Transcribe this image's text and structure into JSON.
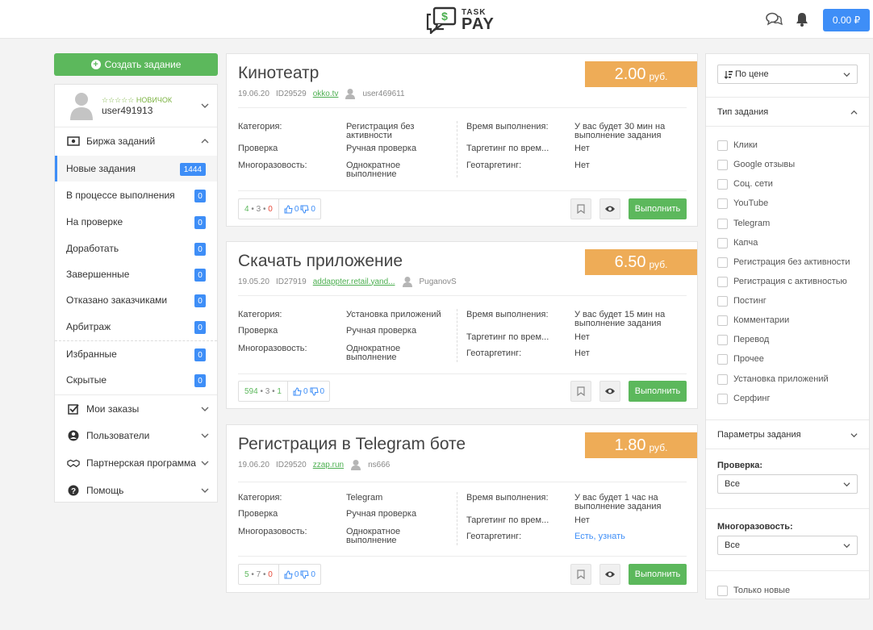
{
  "header": {
    "logo_top": "TASK",
    "logo_bottom": "PAY",
    "balance": "0.00 ₽"
  },
  "sidebar": {
    "create_label": "Создать задание",
    "user": {
      "rank": "☆☆☆☆☆ НОВИЧОК",
      "name": "user491913"
    },
    "exchange_label": "Биржа заданий",
    "items": [
      {
        "label": "Новые задания",
        "count": "1444"
      },
      {
        "label": "В процессе выполнения",
        "count": "0"
      },
      {
        "label": "На проверке",
        "count": "0"
      },
      {
        "label": "Доработать",
        "count": "0"
      },
      {
        "label": "Завершенные",
        "count": "0"
      },
      {
        "label": "Отказано заказчиками",
        "count": "0"
      },
      {
        "label": "Арбитраж",
        "count": "0"
      },
      {
        "label": "Избранные",
        "count": "0"
      },
      {
        "label": "Скрытые",
        "count": "0"
      }
    ],
    "sections": [
      {
        "label": "Мои заказы"
      },
      {
        "label": "Пользователи"
      },
      {
        "label": "Партнерская программа"
      },
      {
        "label": "Помощь"
      }
    ]
  },
  "labels": {
    "category": "Категория:",
    "check": "Проверка",
    "multi": "Многоразовость:",
    "time": "Время выполнения:",
    "time_targeting": "Таргетинг по врем...",
    "geo": "Геотаргетинг:",
    "execute": "Выполнить"
  },
  "tasks": [
    {
      "title": "Кинотеатр",
      "price": "2.00",
      "currency": "руб.",
      "date": "19.06.20",
      "id": "ID29529",
      "site": "okko.tv",
      "author": "user469611",
      "category_1": "Регистрация без",
      "category_2": "активности",
      "check": "Ручная проверка",
      "multi_1": "Однократное",
      "multi_2": "выполнение",
      "time_1": "У вас будет 30 мин на",
      "time_2": "выполнение задания",
      "time_targeting": "Нет",
      "geo": "Нет",
      "stat_a": "4",
      "stat_b": "3",
      "stat_c": "0",
      "likes": "0",
      "dislikes": "0"
    },
    {
      "title": "Скачать приложение",
      "price": "6.50",
      "currency": "руб.",
      "date": "19.05.20",
      "id": "ID27919",
      "site": "addappter.retail.yand...",
      "author": "PuganovS",
      "category_1": "Установка приложений",
      "category_2": "",
      "check": "Ручная проверка",
      "multi_1": "Однократное",
      "multi_2": "выполнение",
      "time_1": "У вас будет 15 мин на",
      "time_2": "выполнение задания",
      "time_targeting": "Нет",
      "geo": "Нет",
      "stat_a": "594",
      "stat_b": "3",
      "stat_c": "1",
      "likes": "0",
      "dislikes": "0"
    },
    {
      "title": "Регистрация в Telegram боте",
      "price": "1.80",
      "currency": "руб.",
      "date": "19.06.20",
      "id": "ID29520",
      "site": "zzap.run",
      "author": "ns666",
      "category_1": "Telegram",
      "category_2": "",
      "check": "Ручная проверка",
      "multi_1": "Однократное",
      "multi_2": "выполнение",
      "time_1": "У вас будет 1 час на",
      "time_2": "выполнение задания",
      "time_targeting": "Нет",
      "geo": "Есть, узнать",
      "stat_a": "5",
      "stat_b": "7",
      "stat_c": "0",
      "likes": "0",
      "dislikes": "0"
    }
  ],
  "filters": {
    "sort_value": "По цене",
    "type_header": "Тип задания",
    "types": [
      "Клики",
      "Google отзывы",
      "Соц. сети",
      "YouTube",
      "Telegram",
      "Капча",
      "Регистрация без активности",
      "Регистрация с активностью",
      "Постинг",
      "Комментарии",
      "Перевод",
      "Прочее",
      "Установка приложений",
      "Серфинг"
    ],
    "params_header": "Параметры задания",
    "check_label": "Проверка:",
    "check_value": "Все",
    "multi_label": "Многоразовость:",
    "multi_value": "Все",
    "only_new": "Только новые"
  },
  "colors": {
    "primary": "#3e8ef7",
    "success": "#5cb85c",
    "price": "#eeac57"
  }
}
